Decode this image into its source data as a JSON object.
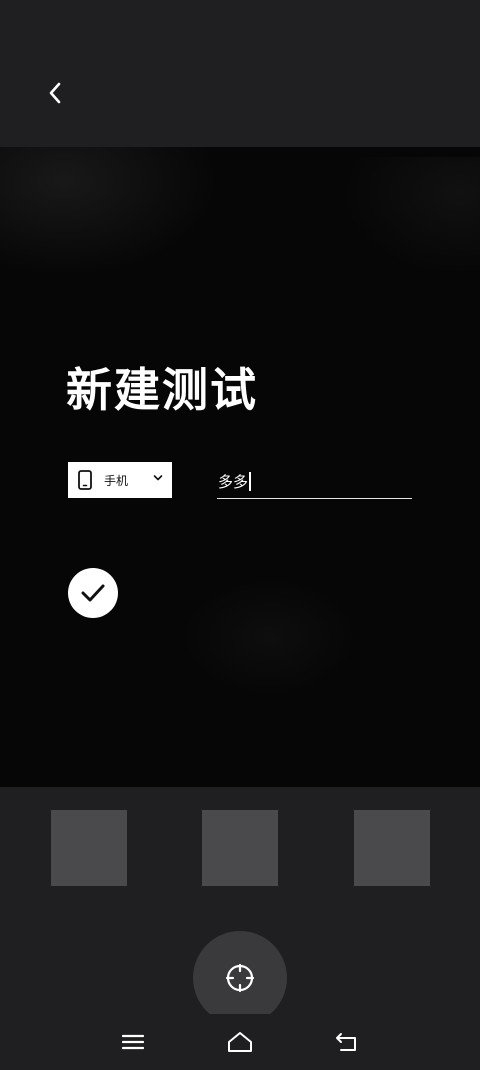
{
  "header": {
    "back_icon": "chevron-left-icon"
  },
  "form": {
    "title": "新建测试",
    "device_select": {
      "icon": "phone-icon",
      "selected": "手机",
      "chevron": "chevron-down-icon"
    },
    "name_field": {
      "value": "多多"
    },
    "confirm_icon": "checkmark-icon"
  },
  "thumbnails": [
    {
      "color": "#4a4a4c"
    },
    {
      "color": "#4a4a4c"
    },
    {
      "color": "#4a4a4c"
    }
  ],
  "capture": {
    "icon": "crosshair-icon"
  },
  "system_nav": {
    "items": [
      "menu-icon",
      "home-icon",
      "back-icon"
    ]
  },
  "colors": {
    "background": "#1f1f21",
    "camera": "#060606",
    "thumbnail": "#4a4a4c",
    "accent": "#ffffff"
  }
}
